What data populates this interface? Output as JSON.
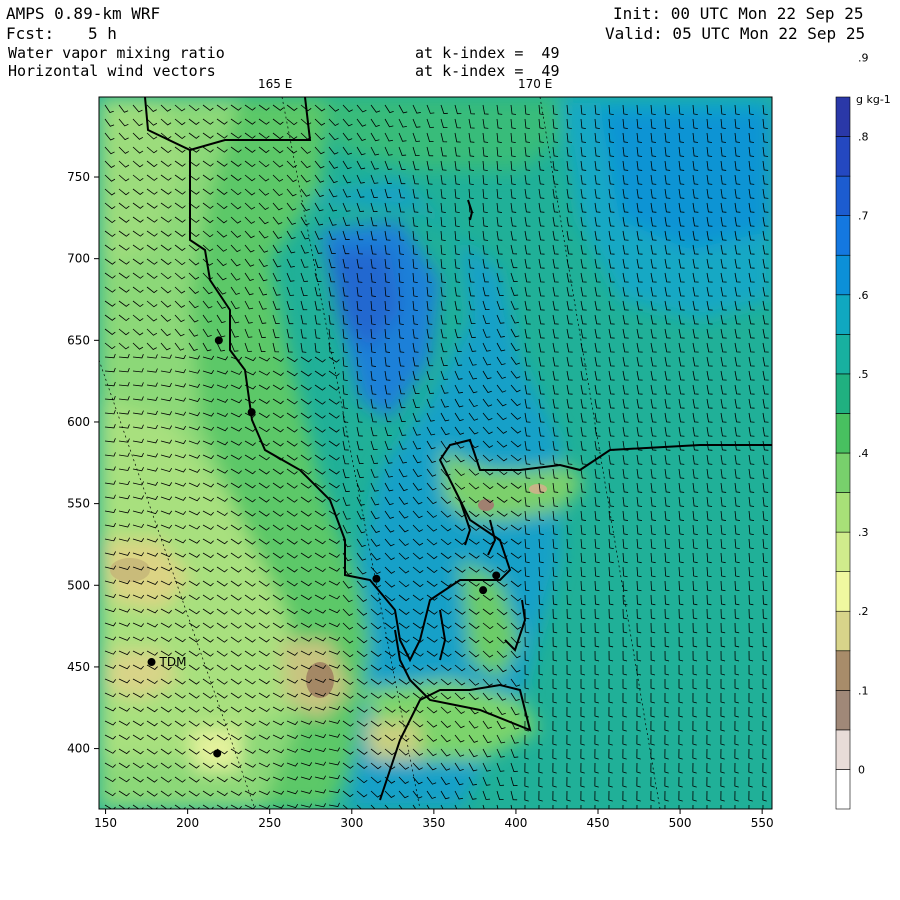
{
  "header": {
    "model": "AMPS 0.89-km WRF",
    "fcst_label": "Fcst:",
    "fcst_value": "5 h",
    "init": "Init: 00 UTC Mon 22 Sep 25",
    "valid": "Valid: 05 UTC Mon 22 Sep 25",
    "field1": "Water vapor mixing ratio",
    "field2": "Horizontal wind vectors",
    "level1": "at k-index =  49",
    "level2": "at k-index =  49"
  },
  "map": {
    "lon_labels": [
      "165 E",
      "170 E"
    ],
    "x_ticks": [
      "150",
      "200",
      "250",
      "300",
      "350",
      "400",
      "450",
      "500",
      "550"
    ],
    "y_ticks": [
      "750",
      "700",
      "650",
      "600",
      "550",
      "500",
      "450",
      "400"
    ],
    "x_range": [
      146,
      556
    ],
    "y_range": [
      363,
      799
    ],
    "station_label": "TDM",
    "stations": [
      [
        219,
        650
      ],
      [
        239,
        606
      ],
      [
        315,
        504
      ],
      [
        380,
        497
      ],
      [
        388,
        506
      ],
      [
        178,
        453
      ],
      [
        218,
        397
      ]
    ]
  },
  "colorbar": {
    "units": "g kg-1",
    "labels": [
      "0",
      ".1",
      ".2",
      ".3",
      ".4",
      ".5",
      ".6",
      ".7",
      ".8",
      ".9"
    ],
    "colors": [
      "#ffffff",
      "#e8dcd8",
      "#a08878",
      "#a88c6a",
      "#d8d48a",
      "#f0f8a0",
      "#d0ec8c",
      "#a8e078",
      "#78d06c",
      "#48c060",
      "#20b080",
      "#18b0a0",
      "#10a8c0",
      "#0c90d8",
      "#1478e0",
      "#1c5cd0",
      "#2448c0",
      "#2a38a8"
    ]
  }
}
